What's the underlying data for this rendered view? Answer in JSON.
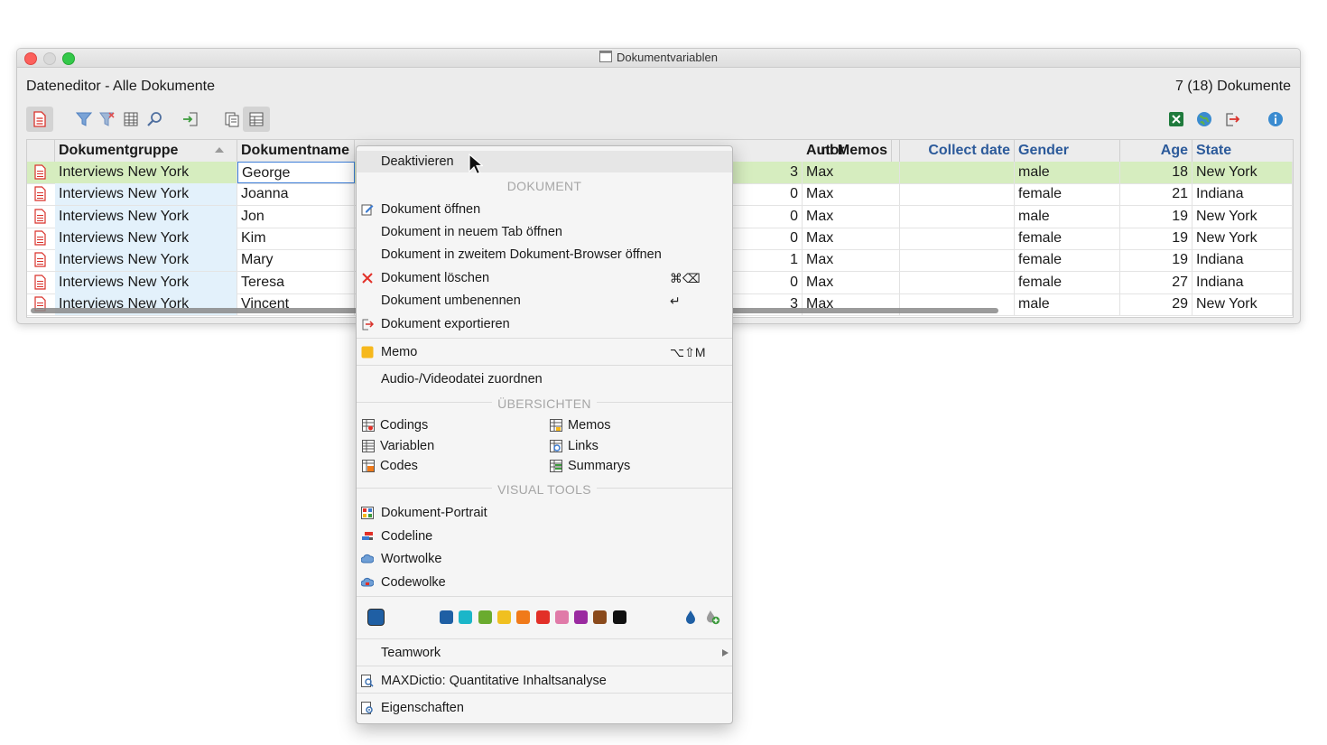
{
  "window": {
    "title": "Dokumentvariablen",
    "heading_left": "Dateneditor - Alle Dokumente",
    "heading_right": "7 (18) Dokumente"
  },
  "toolbar": {
    "icons": [
      "document-icon",
      "filter-icon",
      "filter-clear-icon",
      "columns-icon",
      "search-icon",
      "import-icon",
      "doc-list-icon",
      "doc-variable-icon",
      "excel-icon",
      "globe-icon",
      "export-icon",
      "info-icon"
    ]
  },
  "table": {
    "columns": [
      {
        "label": "Dokumentgruppe"
      },
      {
        "label": "Dokumentname"
      },
      {
        "label": "nl Memos"
      },
      {
        "label": "Autor"
      },
      {
        "label": "Collect date"
      },
      {
        "label": "Gender"
      },
      {
        "label": "Age"
      },
      {
        "label": "State"
      }
    ],
    "rows": [
      {
        "group": "Interviews New York",
        "name": "George",
        "memos": "3",
        "author": "Max",
        "collect": "",
        "gender": "male",
        "age": "18",
        "state": "New York"
      },
      {
        "group": "Interviews New York",
        "name": "Joanna",
        "memos": "0",
        "author": "Max",
        "collect": "",
        "gender": "female",
        "age": "21",
        "state": "Indiana"
      },
      {
        "group": "Interviews New York",
        "name": "Jon",
        "memos": "0",
        "author": "Max",
        "collect": "",
        "gender": "male",
        "age": "19",
        "state": "New York"
      },
      {
        "group": "Interviews New York",
        "name": "Kim",
        "memos": "0",
        "author": "Max",
        "collect": "",
        "gender": "female",
        "age": "19",
        "state": "New York"
      },
      {
        "group": "Interviews New York",
        "name": "Mary",
        "memos": "1",
        "author": "Max",
        "collect": "",
        "gender": "female",
        "age": "19",
        "state": "Indiana"
      },
      {
        "group": "Interviews New York",
        "name": "Teresa",
        "memos": "0",
        "author": "Max",
        "collect": "",
        "gender": "female",
        "age": "27",
        "state": "Indiana"
      },
      {
        "group": "Interviews New York",
        "name": "Vincent",
        "memos": "3",
        "author": "Max",
        "collect": "",
        "gender": "male",
        "age": "29",
        "state": "New York"
      }
    ]
  },
  "menu": {
    "deactivate": "Deaktivieren",
    "section_document": "DOKUMENT",
    "open": "Dokument öffnen",
    "open_tab": "Dokument in neuem Tab öffnen",
    "open_second": "Dokument in zweitem Dokument-Browser öffnen",
    "delete": "Dokument löschen",
    "delete_shortcut": "⌘⌫",
    "rename": "Dokument umbenennen",
    "rename_shortcut": "↵",
    "export": "Dokument exportieren",
    "memo": "Memo",
    "memo_shortcut": "⌥⇧M",
    "assign_media": "Audio-/Videodatei zuordnen",
    "section_overviews": "ÜBERSICHTEN",
    "ov_codings": "Codings",
    "ov_memos": "Memos",
    "ov_variables": "Variablen",
    "ov_links": "Links",
    "ov_codes": "Codes",
    "ov_summaries": "Summarys",
    "section_visual": "VISUAL TOOLS",
    "portrait": "Dokument-Portrait",
    "codeline": "Codeline",
    "wordcloud": "Wortwolke",
    "codecloud": "Codewolke",
    "current_color": "#1f5fa4",
    "colors": [
      "#1f5fa4",
      "#1bb6c9",
      "#6aab2e",
      "#f0c020",
      "#f07a1a",
      "#e23028",
      "#e07aa8",
      "#9a2aa0",
      "#8a4a1c",
      "#111111"
    ],
    "teamwork": "Teamwork",
    "maxdictio": "MAXDictio: Quantitative Inhaltsanalyse",
    "properties": "Eigenschaften"
  }
}
